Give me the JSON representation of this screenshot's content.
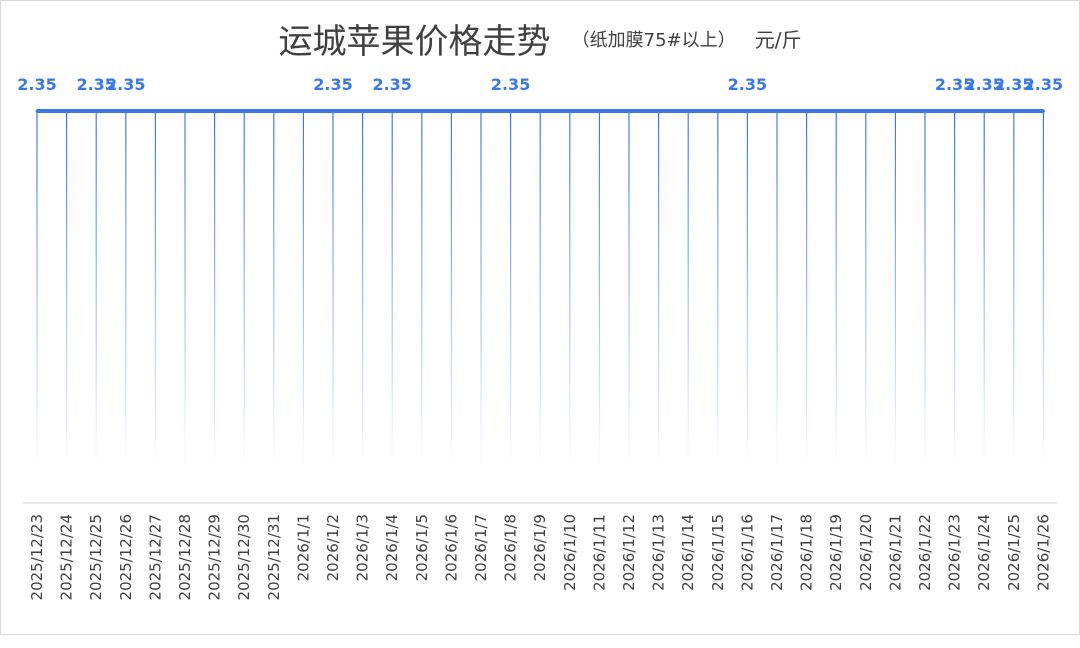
{
  "chart_data": {
    "type": "line",
    "title": "运城苹果价格走势",
    "subtitle": "（纸加膜75#以上）",
    "unit": "元/斤",
    "categories": [
      "2025/12/23",
      "2025/12/24",
      "2025/12/25",
      "2025/12/26",
      "2025/12/27",
      "2025/12/28",
      "2025/12/29",
      "2025/12/30",
      "2025/12/31",
      "2026/1/1",
      "2026/1/2",
      "2026/1/3",
      "2026/1/4",
      "2026/1/5",
      "2026/1/6",
      "2026/1/7",
      "2026/1/8",
      "2026/1/9",
      "2026/1/10",
      "2026/1/11",
      "2026/1/12",
      "2026/1/13",
      "2026/1/14",
      "2026/1/15",
      "2026/1/16",
      "2026/1/17",
      "2026/1/18",
      "2026/1/19",
      "2026/1/20",
      "2026/1/21",
      "2026/1/22",
      "2026/1/23",
      "2026/1/24",
      "2026/1/25",
      "2026/1/26"
    ],
    "values": [
      2.35,
      2.35,
      2.35,
      2.35,
      2.35,
      2.35,
      2.35,
      2.35,
      2.35,
      2.35,
      2.35,
      2.35,
      2.35,
      2.35,
      2.35,
      2.35,
      2.35,
      2.35,
      2.35,
      2.35,
      2.35,
      2.35,
      2.35,
      2.35,
      2.35,
      2.35,
      2.35,
      2.35,
      2.35,
      2.35,
      2.35,
      2.35,
      2.35,
      2.35,
      2.35
    ],
    "data_labels_shown": [
      0,
      2,
      3,
      10,
      12,
      16,
      24,
      31,
      32,
      33,
      34
    ],
    "colors": {
      "line": "#3b78e7",
      "label": "#3b78e7",
      "axis": "#d9d9d9",
      "tick": "#404040"
    },
    "grid": false,
    "legend": "none"
  }
}
